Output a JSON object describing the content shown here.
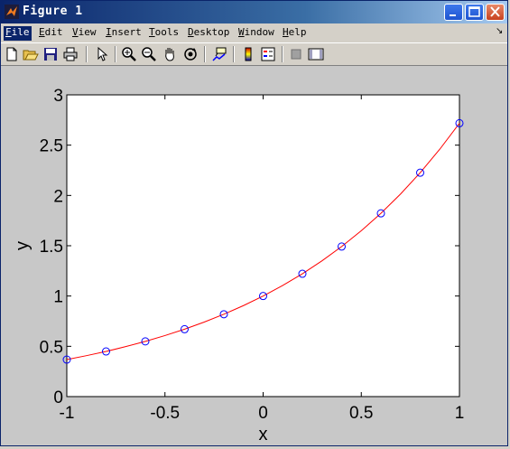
{
  "window": {
    "title": "Figure 1"
  },
  "menu": [
    "File",
    "Edit",
    "View",
    "Insert",
    "Tools",
    "Desktop",
    "Window",
    "Help"
  ],
  "menu_mnemonic": [
    "F",
    "E",
    "V",
    "I",
    "T",
    "D",
    "W",
    "H"
  ],
  "toolbar": [
    "new-figure",
    "open-file",
    "save",
    "print",
    "select-arrow",
    "zoom-in",
    "zoom-out",
    "pan",
    "rotate-3d",
    "data-cursor",
    "insert-colorbar",
    "insert-legend",
    "hide-plot-tools",
    "show-plot-tools"
  ],
  "colors": {
    "line": "#ff0000",
    "markers": "#0000ff",
    "figure_bg": "#c8c8c8"
  },
  "chart_data": {
    "type": "line",
    "xlabel": "x",
    "ylabel": "y",
    "xlim": [
      -1,
      1
    ],
    "ylim": [
      0,
      3
    ],
    "xticks": [
      "-1",
      "-0.5",
      "0",
      "0.5",
      "1"
    ],
    "yticks": [
      "0",
      "0.5",
      "1",
      "1.5",
      "2",
      "2.5",
      "3"
    ],
    "grid": false,
    "series": [
      {
        "style": "solid-red-line",
        "x": [
          -1,
          -0.9,
          -0.8,
          -0.7,
          -0.6,
          -0.5,
          -0.4,
          -0.3,
          -0.2,
          -0.1,
          0,
          0.1,
          0.2,
          0.3,
          0.4,
          0.5,
          0.6,
          0.7,
          0.8,
          0.9,
          1
        ],
        "y": [
          0.368,
          0.407,
          0.449,
          0.497,
          0.549,
          0.607,
          0.67,
          0.741,
          0.819,
          0.905,
          1.0,
          1.105,
          1.221,
          1.35,
          1.492,
          1.649,
          1.822,
          2.014,
          2.226,
          2.46,
          2.718
        ]
      },
      {
        "style": "blue-circle-markers",
        "x": [
          -1,
          -0.8,
          -0.6,
          -0.4,
          -0.2,
          0,
          0.2,
          0.4,
          0.6,
          0.8,
          1
        ],
        "y": [
          0.368,
          0.449,
          0.549,
          0.67,
          0.819,
          1.0,
          1.221,
          1.492,
          1.822,
          2.226,
          2.718
        ]
      }
    ]
  }
}
